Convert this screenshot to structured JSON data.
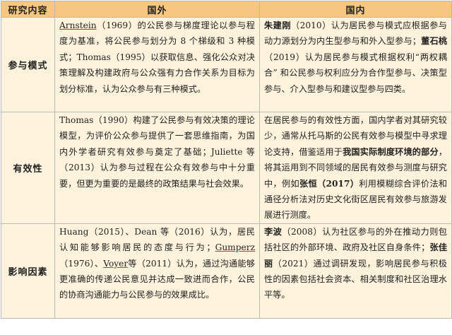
{
  "headers": {
    "col1": "研究内容",
    "col2": "国外",
    "col3": "国内"
  },
  "rows": [
    {
      "label": "参与模式",
      "foreign": {
        "t1": "Arnstein",
        "t2": "（1969）的公民参与梯度理论以参与程度为基准，将公民参与划分为 8 个梯级和 3 种模式；Thomas（1995）以获取信息、强化公众对决策理解及构建政府与公众强有力合作关系为目标为划分标准，认为公众参与有三种模式。"
      },
      "domestic": {
        "t1": "朱建刚",
        "t2": "（2010）认为居民参与模式应根据参与动力源划分为内生型参与和外入型参与；",
        "t3": "董石桃",
        "t4": "（2019）认为居民参与模式根据权利“两权耦合” 和公民参与权利应分为合作型参与、决策型参与、介入型参与和建议型参与四类。"
      }
    },
    {
      "label": "有效性",
      "foreign": {
        "t1": "Thomas（1990）构建了公民参与有效决策的理论模型，为评价公众参与提供了一套思维指南，为国内外学者研究有效参与奠定了基础；Juliette 等（2013）认为参与过程在公众有效参与中十分重要，但更为重要的是最终的政策结果与社会效果。"
      },
      "domestic": {
        "t1": "在居民参与的有效性方面，国内学者对其研究较少，通常从托马斯的公民有效参与模型中寻求理论支持，借鉴适用于",
        "t2": "我国实际制度环境的部分",
        "t3": "，将其运用到不同领域的居民有效参与测度与研究中，例如",
        "t4": "张恒（2017）",
        "t5": "利用模糊综合评价法和通径分析法对历史文化街区居民有效参与旅游发展进行测度。"
      }
    },
    {
      "label": "影响因素",
      "foreign": {
        "t1": "Huang（2015）、Dean 等（2016）认为，居民认知能够影响居民的态度与行为；",
        "t2": "Gumperz",
        "t3": "（1976）、",
        "t4": "Voyer",
        "t5": "等（2011）认为，通过沟通能够更准确的传递公民意见并达成一致进而合作，公民的协商沟通能力与公民参与的效果成比。"
      },
      "domestic": {
        "t1": "李波",
        "t2": "（2008）认为社区参与的外在推动力则包括社区的外部环境、政府及社区自身条件；",
        "t3": "张佳丽",
        "t4": "（2021）通过调研发现，影响居民参与积极性的因素包括社会资本、相关制度和社区治理水平等。"
      }
    }
  ]
}
